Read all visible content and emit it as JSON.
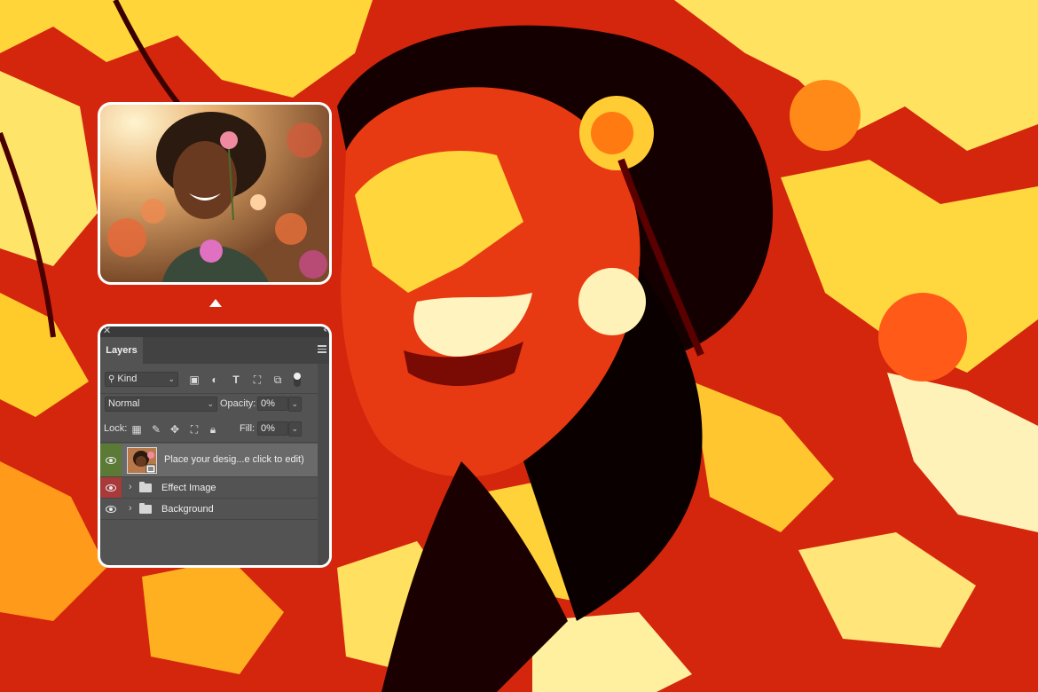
{
  "panel": {
    "tab_label": "Layers",
    "kind_filter": "Kind",
    "blend_mode": "Normal",
    "opacity_label": "Opacity:",
    "opacity_value": "0%",
    "lock_label": "Lock:",
    "fill_label": "Fill:",
    "fill_value": "0%",
    "layers": [
      {
        "name": "Place your desig...e click to edit)",
        "type": "smart-object",
        "visibility_color": "#5a7a36",
        "selected": true
      },
      {
        "name": "Effect Image",
        "type": "group",
        "visibility_color": "#a83a3a",
        "selected": false
      },
      {
        "name": "Background",
        "type": "group",
        "visibility_color": "#535353",
        "selected": false
      }
    ]
  },
  "colors": {
    "poster_red": "#c8200c",
    "poster_yellow": "#ffe24a",
    "poster_cream": "#fff6c8",
    "poster_black": "#0b0000",
    "panel_bg": "#535353"
  }
}
